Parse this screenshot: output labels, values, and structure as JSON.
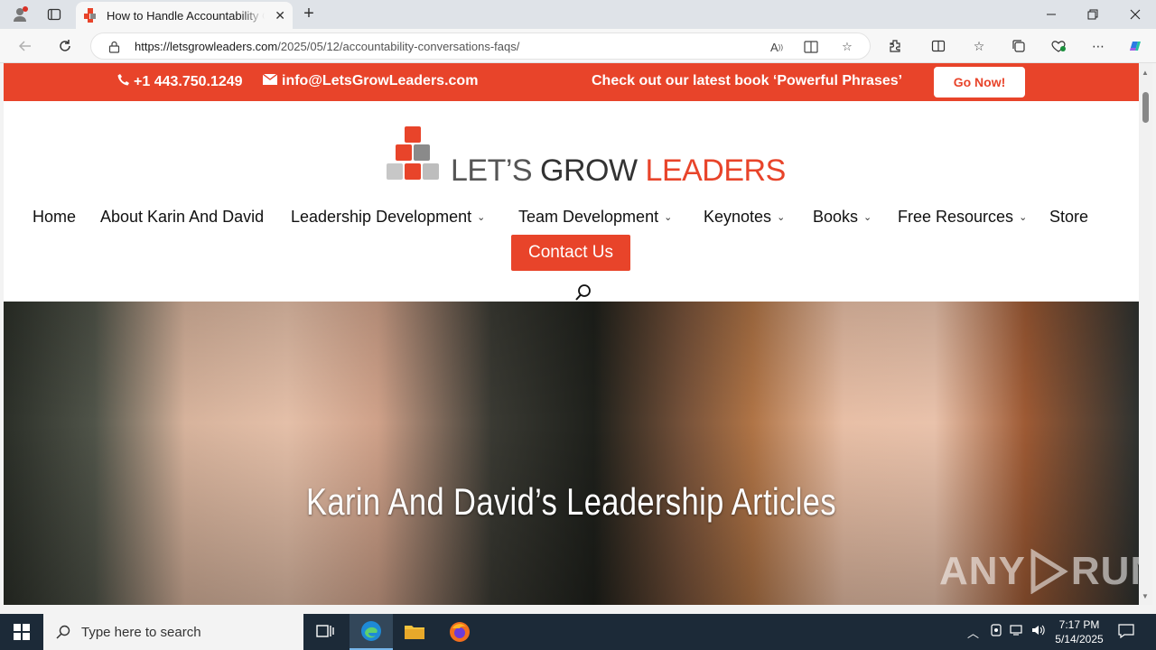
{
  "browser": {
    "tab_title": "How to Handle Accountability Conversations",
    "url_host": "https://letsgrowleaders.com",
    "url_path": "/2025/05/12/accountability-conversations-faqs/"
  },
  "topbar": {
    "phone": "+1 443.750.1249",
    "email": "info@LetsGrowLeaders.com",
    "promo": "Check out our latest book ‘Powerful Phrases’",
    "cta": "Go Now!"
  },
  "logo": {
    "part1": "LET’S ",
    "part2": "GROW ",
    "part3": "LEADERS"
  },
  "nav": {
    "items": [
      {
        "label": "Home"
      },
      {
        "label": "About Karin And David"
      },
      {
        "label": "Leadership Development"
      },
      {
        "label": "Team Development"
      },
      {
        "label": "Keynotes"
      },
      {
        "label": "Books"
      },
      {
        "label": "Free Resources"
      },
      {
        "label": "Store"
      }
    ],
    "contact": "Contact Us"
  },
  "hero": {
    "title": "Karin And David’s Leadership Articles"
  },
  "watermark": {
    "text1": "ANY",
    "text2": "RUN"
  },
  "taskbar": {
    "search_placeholder": "Type here to search",
    "time": "7:17 PM",
    "date": "5/14/2025"
  },
  "colors": {
    "brand": "#e8442a",
    "taskbar": "#1c2a38"
  }
}
